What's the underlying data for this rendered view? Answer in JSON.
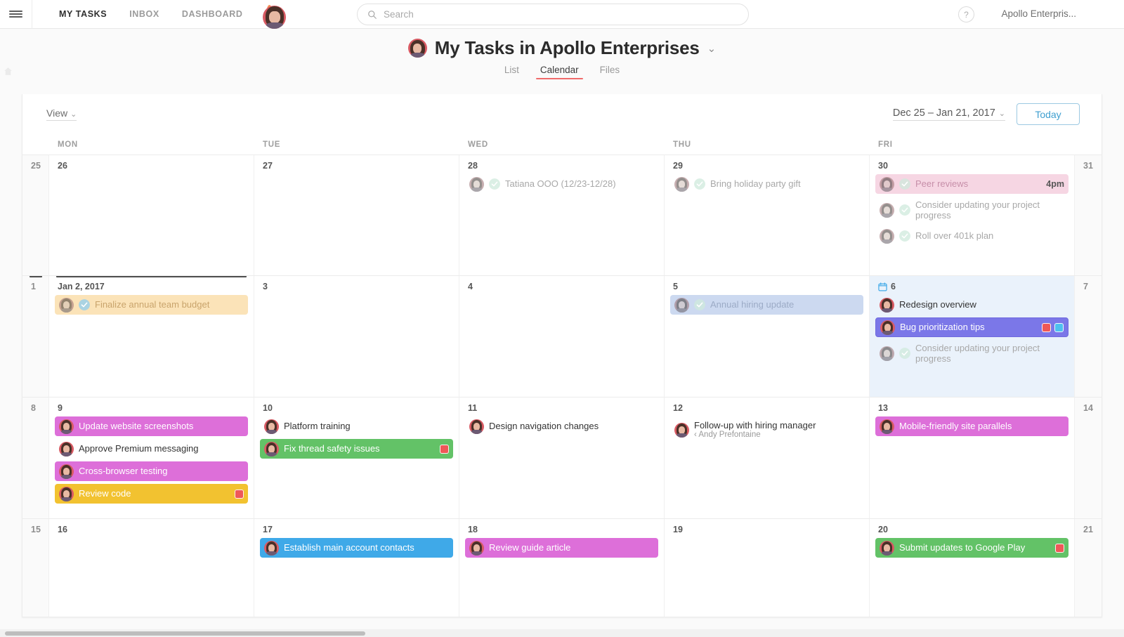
{
  "topbar": {
    "menu_icon": "hamburger-icon",
    "nav": [
      {
        "label": "MY TASKS",
        "active": true
      },
      {
        "label": "INBOX",
        "active": false
      },
      {
        "label": "DASHBOARD",
        "active": false
      }
    ],
    "add_button_icon": "plus-icon",
    "search": {
      "placeholder": "Search",
      "value": "",
      "icon": "search-icon"
    },
    "help_label": "?",
    "workspace": "Apollo Enterpris...",
    "avatar": "user-avatar"
  },
  "page": {
    "title": "My Tasks in Apollo Enterprises",
    "title_caret": "⌄",
    "tabs": [
      {
        "label": "List",
        "active": false
      },
      {
        "label": "Calendar",
        "active": true
      },
      {
        "label": "Files",
        "active": false
      }
    ]
  },
  "toolbar": {
    "view_label": "View",
    "view_caret": "⌄",
    "date_range": "Dec 25 – Jan 21, 2017",
    "range_caret": "⌄",
    "today_label": "Today"
  },
  "calendar": {
    "day_headers": [
      "",
      "MON",
      "TUE",
      "WED",
      "THU",
      "FRI",
      ""
    ],
    "weeks": [
      {
        "days": [
          {
            "num": "25",
            "weekend": true,
            "tasks": []
          },
          {
            "num": "26",
            "tasks": []
          },
          {
            "num": "27",
            "tasks": []
          },
          {
            "num": "28",
            "tasks": [
              {
                "text": "Tatiana OOO (12/23-12/28)",
                "style": "c-muted",
                "check": "done-muted",
                "avatar": "pale"
              }
            ]
          },
          {
            "num": "29",
            "tasks": [
              {
                "text": "Bring holiday party gift",
                "style": "c-muted",
                "check": "done-muted",
                "avatar": "pale"
              }
            ]
          },
          {
            "num": "30",
            "tasks": [
              {
                "text": "Peer reviews",
                "style": "c-pink-sf",
                "check": "done-muted",
                "avatar": "pale",
                "time": "4pm"
              },
              {
                "text": "Consider updating your project progress",
                "style": "c-muted",
                "check": "done-muted",
                "avatar": "pale",
                "tall": true
              },
              {
                "text": "Roll over 401k plan",
                "style": "c-muted",
                "check": "done-muted",
                "avatar": "pale"
              }
            ]
          },
          {
            "num": "31",
            "weekend": true,
            "tasks": []
          }
        ]
      },
      {
        "days": [
          {
            "num": "1",
            "weekend": true,
            "marker": true,
            "tasks": []
          },
          {
            "num": "Jan 2, 2017",
            "marker": true,
            "tasks": [
              {
                "text": "Finalize annual team budget",
                "style": "c-orange",
                "check": "done-blue",
                "avatar": "pale"
              }
            ]
          },
          {
            "num": "3",
            "tasks": []
          },
          {
            "num": "4",
            "tasks": []
          },
          {
            "num": "5",
            "tasks": [
              {
                "text": "Annual hiring update",
                "style": "c-blue-sf",
                "check": "done-muted",
                "avatar": "pale"
              }
            ]
          },
          {
            "num": "6",
            "today": true,
            "today_icon": "calendar-today-icon",
            "tasks": [
              {
                "text": "Redesign overview",
                "style": "c-plain",
                "avatar": "normal"
              },
              {
                "text": "Bug prioritization tips",
                "style": "c-purple",
                "avatar": "normal",
                "badges": [
                  "b-red",
                  "b-cyan"
                ]
              },
              {
                "text": "Consider updating your project progress",
                "style": "c-muted",
                "check": "done-muted",
                "avatar": "pale",
                "tall": true
              }
            ]
          },
          {
            "num": "7",
            "weekend": true,
            "tasks": []
          }
        ]
      },
      {
        "days": [
          {
            "num": "8",
            "weekend": true,
            "tasks": []
          },
          {
            "num": "9",
            "tasks": [
              {
                "text": "Update website screenshots",
                "style": "c-magenta",
                "avatar": "normal"
              },
              {
                "text": "Approve Premium messaging",
                "style": "c-plain",
                "avatar": "normal"
              },
              {
                "text": "Cross-browser testing",
                "style": "c-magenta",
                "avatar": "normal"
              },
              {
                "text": "Review code",
                "style": "c-yellow",
                "avatar": "normal",
                "badges": [
                  "b-red"
                ]
              }
            ]
          },
          {
            "num": "10",
            "tasks": [
              {
                "text": "Platform training",
                "style": "c-plain",
                "avatar": "normal"
              },
              {
                "text": "Fix thread safety issues",
                "style": "c-green",
                "avatar": "normal",
                "badges": [
                  "b-red"
                ]
              }
            ]
          },
          {
            "num": "11",
            "tasks": [
              {
                "text": "Design navigation changes",
                "style": "c-plain",
                "avatar": "normal"
              }
            ]
          },
          {
            "num": "12",
            "tasks": [
              {
                "text": "Follow-up with hiring manager",
                "sub": "‹ Andy Prefontaine",
                "style": "c-plain",
                "avatar": "normal",
                "tall": true
              }
            ]
          },
          {
            "num": "13",
            "tasks": [
              {
                "text": "Mobile-friendly site parallels",
                "style": "c-magenta",
                "avatar": "normal"
              }
            ]
          },
          {
            "num": "14",
            "weekend": true,
            "tasks": []
          }
        ]
      },
      {
        "days": [
          {
            "num": "15",
            "weekend": true,
            "tasks": []
          },
          {
            "num": "16",
            "tasks": []
          },
          {
            "num": "17",
            "tasks": [
              {
                "text": "Establish main account contacts",
                "style": "c-azure",
                "avatar": "normal"
              }
            ]
          },
          {
            "num": "18",
            "tasks": [
              {
                "text": "Review guide article",
                "style": "c-magenta",
                "avatar": "normal"
              }
            ]
          },
          {
            "num": "19",
            "tasks": []
          },
          {
            "num": "20",
            "tasks": [
              {
                "text": "Submit updates to Google Play",
                "style": "c-green",
                "avatar": "normal",
                "badges": [
                  "b-red"
                ]
              }
            ]
          },
          {
            "num": "21",
            "weekend": true,
            "tasks": []
          }
        ]
      }
    ]
  },
  "colors": {
    "accent_red": "#f06a6a",
    "today_blue": "#3fa9e8",
    "today_cell": "#eaf2fb",
    "magenta": "#dd6fd9",
    "purple": "#7b77e8",
    "green": "#63c267",
    "yellow": "#f2c230",
    "azure": "#3fa9e8",
    "soft_pink": "#f6d6e3",
    "soft_orange": "#fbe3b8",
    "soft_blue": "#ccd9f0"
  }
}
